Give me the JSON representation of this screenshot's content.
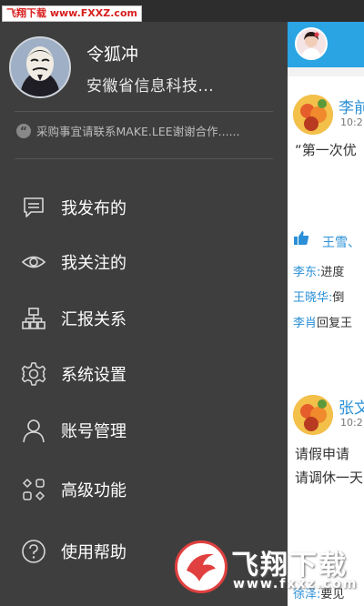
{
  "watermark_top": "飞翔下载 www.FXXZ.com",
  "profile": {
    "name": "令狐冲",
    "company": "安徽省信息科技...",
    "signature": "采购事宜请联系MAKE.LEE谢谢合作......"
  },
  "menu": [
    {
      "label": "我发布的",
      "icon": "message-icon"
    },
    {
      "label": "我关注的",
      "icon": "eye-icon"
    },
    {
      "label": "汇报关系",
      "icon": "org-chart-icon"
    },
    {
      "label": "系统设置",
      "icon": "gear-icon"
    },
    {
      "label": "账号管理",
      "icon": "person-icon"
    },
    {
      "label": "高级功能",
      "icon": "grid-icon"
    },
    {
      "label": "使用帮助",
      "icon": "help-icon"
    }
  ],
  "feed": {
    "post1": {
      "author": "李前",
      "time": "10:2",
      "text": "“第一次优",
      "likes": "王雪、",
      "comments": [
        {
          "name": "李东:",
          "text": "进度"
        },
        {
          "name": "王晓华:",
          "text": "倒"
        },
        {
          "name": "李肖",
          "text": "回复王"
        }
      ]
    },
    "post2": {
      "author": "张文",
      "time": "10:2",
      "line1": "请假申请",
      "line2": "请调休一天",
      "comment": {
        "name": "徐泽:",
        "text": "要见"
      }
    }
  },
  "watermark_bottom": {
    "title": "飞翔下载",
    "url": "www.fxxz.com"
  },
  "colors": {
    "drawer": "#3e3e3e",
    "accent": "#2aa4e2",
    "link": "#2a8fd6"
  }
}
